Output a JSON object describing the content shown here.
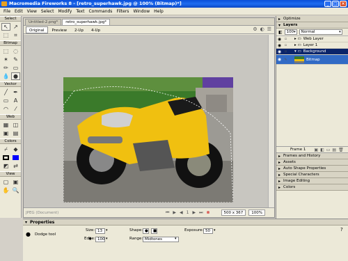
{
  "window": {
    "title": "Macromedia Fireworks 8 - [retro_superhawk.jpg @ 100% (Bitmap)*]",
    "controls": [
      "_",
      "□",
      "×"
    ]
  },
  "menu": [
    "File",
    "Edit",
    "View",
    "Select",
    "Modify",
    "Text",
    "Commands",
    "Filters",
    "Window",
    "Help"
  ],
  "toolbox": {
    "sections": [
      "Select",
      "Bitmap",
      "Vector",
      "Web",
      "Colors",
      "View"
    ]
  },
  "document": {
    "tabs": [
      "Untitled-2.png*",
      "retro_superhawk.jpg*"
    ],
    "view_buttons": [
      "Original",
      "Preview",
      "2-Up",
      "4-Up"
    ],
    "status_left": "JPEG (Document)",
    "frame_number": "1",
    "image_size": "500 x 367",
    "zoom": "100%"
  },
  "panels": {
    "optimize": "Optimize",
    "layers": {
      "title": "Layers",
      "opacity": "100",
      "blend": "Normal",
      "rows": [
        {
          "name": "Web Layer"
        },
        {
          "name": "Layer 1"
        },
        {
          "name": "Background"
        },
        {
          "name": "Bitmap"
        }
      ],
      "frame": "Frame 1"
    },
    "collapsed": [
      "Frames and History",
      "Assets",
      "Auto Shape Properties",
      "Special Characters",
      "Image Editing",
      "Colors"
    ]
  },
  "properties": {
    "title": "Properties",
    "tool_name": "Dodge tool",
    "size_label": "Size:",
    "size_value": "13",
    "edge_label": "Edge:",
    "edge_value": "100",
    "shape_label": "Shape:",
    "range_label": "Range:",
    "range_value": "Midtones",
    "exposure_label": "Exposure:",
    "exposure_value": "50"
  }
}
